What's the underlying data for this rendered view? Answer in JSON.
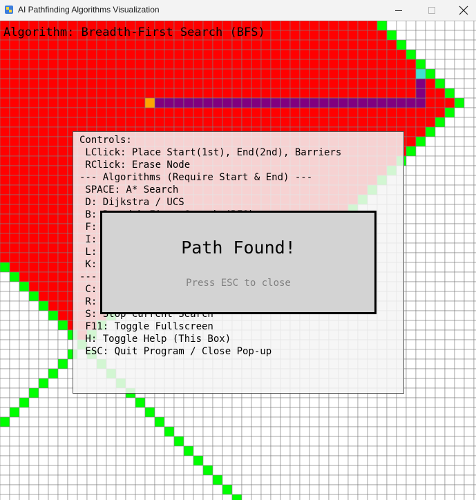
{
  "window": {
    "title": "AI Pathfinding Algorithms Visualization",
    "minimize_icon": "minimize-icon",
    "maximize_icon": "maximize-icon",
    "close_icon": "close-icon"
  },
  "algorithm_label": "Algorithm: Breadth-First Search (BFS)",
  "grid": {
    "cell_colors": {
      "empty": "#ffffff",
      "closed": "#ff0000",
      "open": "#00ff00",
      "path": "#800080",
      "start": "#ffa500",
      "end": "#40e0d0",
      "grid_line": "#808080"
    },
    "start_node": {
      "col": 15,
      "row": 8
    },
    "end_node": {
      "col": 43,
      "row": 5
    },
    "path_nodes": [
      [
        16,
        8
      ],
      [
        17,
        8
      ],
      [
        18,
        8
      ],
      [
        19,
        8
      ],
      [
        20,
        8
      ],
      [
        21,
        8
      ],
      [
        22,
        8
      ],
      [
        23,
        8
      ],
      [
        24,
        8
      ],
      [
        25,
        8
      ],
      [
        26,
        8
      ],
      [
        27,
        8
      ],
      [
        28,
        8
      ],
      [
        29,
        8
      ],
      [
        30,
        8
      ],
      [
        31,
        8
      ],
      [
        32,
        8
      ],
      [
        33,
        8
      ],
      [
        34,
        8
      ],
      [
        35,
        8
      ],
      [
        36,
        8
      ],
      [
        37,
        8
      ],
      [
        38,
        8
      ],
      [
        39,
        8
      ],
      [
        40,
        8
      ],
      [
        41,
        8
      ],
      [
        42,
        8
      ],
      [
        43,
        8
      ],
      [
        43,
        7
      ],
      [
        43,
        6
      ]
    ]
  },
  "help": {
    "lines": [
      "Controls:",
      " LClick: Place Start(1st), End(2nd), Barriers",
      " RClick: Erase Node",
      "--- Algorithms (Require Start & End) ---",
      " SPACE: A* Search",
      " D: Dijkstra / UCS",
      " B: Breadth-First Search (BFS)",
      " F: Depth-First Search (DFS)",
      " I: Iterative Deepening (IDDFS)",
      " L: Depth-Limited Search (DLS)",
      " K: Bidirectional Search",
      "--- Other ---",
      " C: Clear Grid",
      " R: Reset Search",
      " S: Stop Current Search",
      " F11: Toggle Fullscreen",
      " H: Toggle Help (This Box)",
      " ESC: Quit Program / Close Pop-up"
    ]
  },
  "popup": {
    "message": "Path Found!",
    "hint": "Press ESC to close"
  }
}
